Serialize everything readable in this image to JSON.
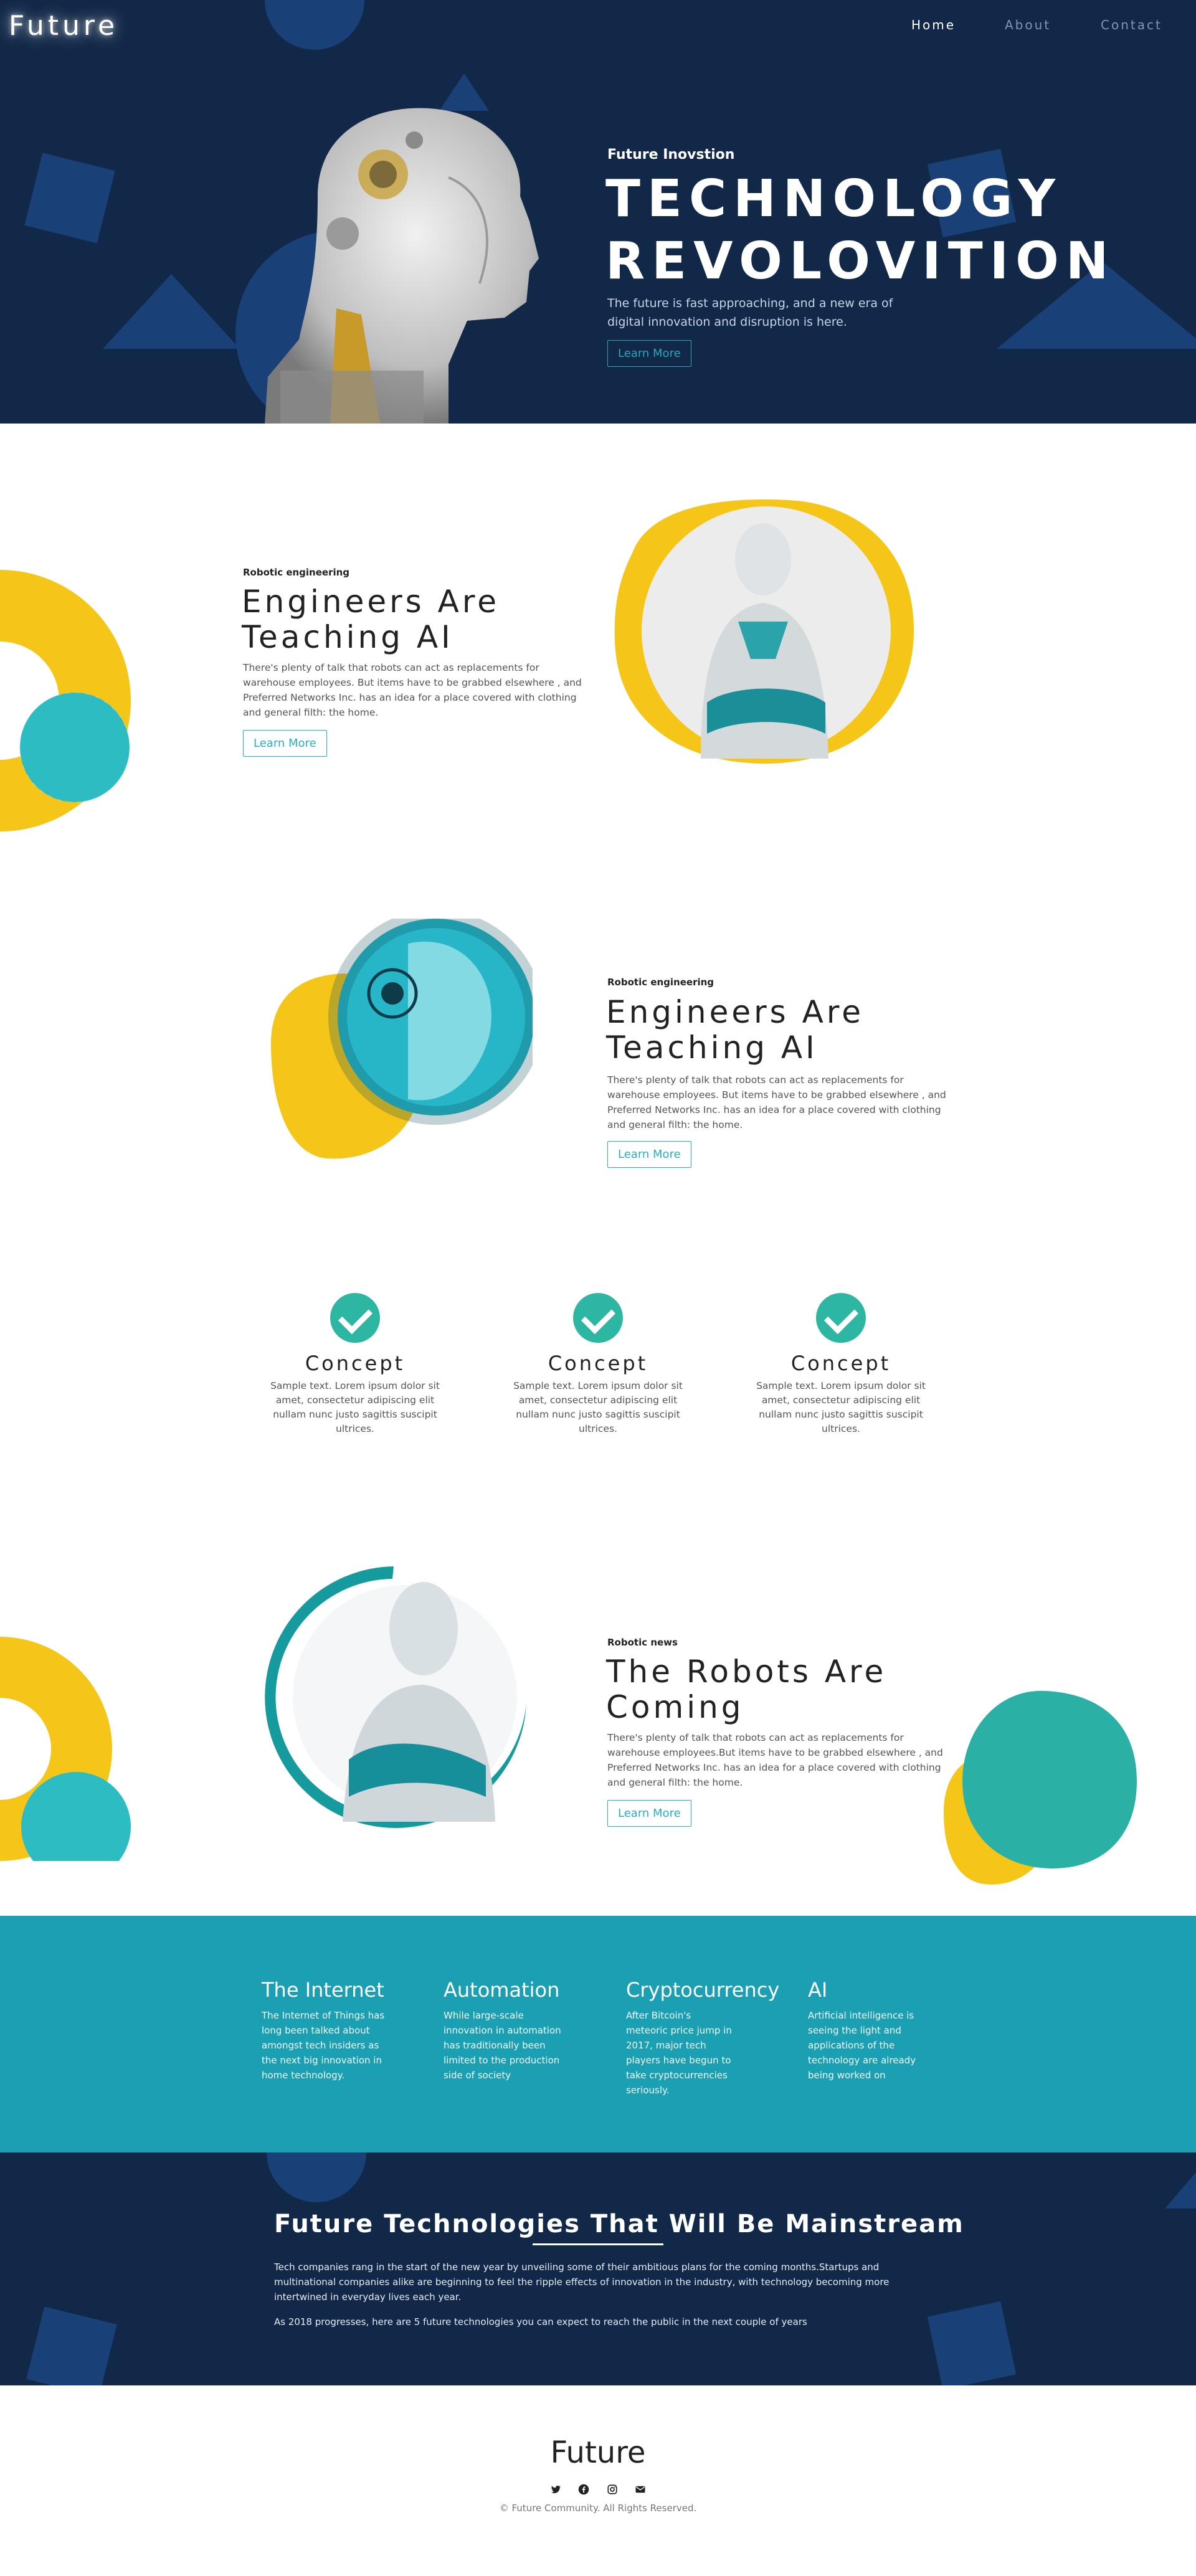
{
  "header": {
    "logo": "Future",
    "nav": [
      {
        "label": "Home",
        "active": true
      },
      {
        "label": "About",
        "active": false
      },
      {
        "label": "Contact",
        "active": false
      }
    ]
  },
  "hero": {
    "subtitle": "Future Inovstion",
    "title_line1": "TECHNOLOGY",
    "title_line2": "REVOLOVITION",
    "description": "The future is fast approaching, and a new era of digital innovation and disruption is here.",
    "button": "Learn More"
  },
  "section1": {
    "eyebrow": "Robotic engineering",
    "title_line1": "Engineers Are",
    "title_line2": "Teaching AI",
    "text": "There's plenty of talk that robots can act as replacements for warehouse employees. But items have to be grabbed elsewhere , and Preferred Networks Inc. has an idea for a place covered with clothing and general filth: the home.",
    "button": "Learn More"
  },
  "section2": {
    "eyebrow": "Robotic engineering",
    "title_line1": "Engineers Are",
    "title_line2": "Teaching AI",
    "text": "There's plenty of talk that robots can act as replacements for warehouse employees. But items have to be grabbed elsewhere , and Preferred Networks Inc. has an idea for a place covered with clothing and general filth: the home.",
    "button": "Learn More"
  },
  "concepts": [
    {
      "title": "Concept",
      "text": "Sample text. Lorem ipsum dolor sit amet, consectetur adipiscing elit nullam nunc justo sagittis suscipit ultrices."
    },
    {
      "title": "Concept",
      "text": "Sample text. Lorem ipsum dolor sit amet, consectetur adipiscing elit nullam nunc justo sagittis suscipit ultrices."
    },
    {
      "title": "Concept",
      "text": "Sample text. Lorem ipsum dolor sit amet, consectetur adipiscing elit nullam nunc justo sagittis suscipit ultrices."
    }
  ],
  "section3": {
    "eyebrow": "Robotic news",
    "title_line1": "The Robots Are",
    "title_line2": "Coming",
    "text": "There's plenty of talk that robots can act as replacements for warehouse employees.But items have to be grabbed elsewhere , and Preferred Networks Inc. has an idea for a place covered with clothing and general filth: the home.",
    "button": "Learn More"
  },
  "topics": [
    {
      "title": "The Internet",
      "text": "The Internet of Things has long been talked about amongst tech insiders as the next big innovation in home technology."
    },
    {
      "title": "Automation",
      "text": "While large-scale innovation in automation has traditionally been limited to the production side of society"
    },
    {
      "title": "Cryptocurrency",
      "text": "After Bitcoin's meteoric price jump in 2017, major tech players have begun to take cryptocurrencies seriously."
    },
    {
      "title": "AI",
      "text": "Artificial intelligence is seeing the light and applications of the technology are already being worked on"
    }
  ],
  "mainstream": {
    "title": "Future Technologies That Will Be Mainstream",
    "paragraph1": "Tech companies rang in the start of the new year by unveiling some of their ambitious plans for the coming months.Startups and multinational companies alike are beginning to feel the ripple effects of innovation in the industry, with technology becoming more intertwined in everyday lives each year.",
    "paragraph2": "As 2018 progresses, here are 5 future technologies you can expect to reach the public in the next couple of years"
  },
  "footer": {
    "logo": "Future",
    "social_icons": [
      "twitter-icon",
      "facebook-icon",
      "instagram-icon",
      "email-icon"
    ],
    "copyright": "© Future Community. All Rights Reserved."
  },
  "colors": {
    "navy": "#112848",
    "teal": "#1a9fb3",
    "yellow": "#f5c518",
    "check_green": "#2db7a3"
  }
}
